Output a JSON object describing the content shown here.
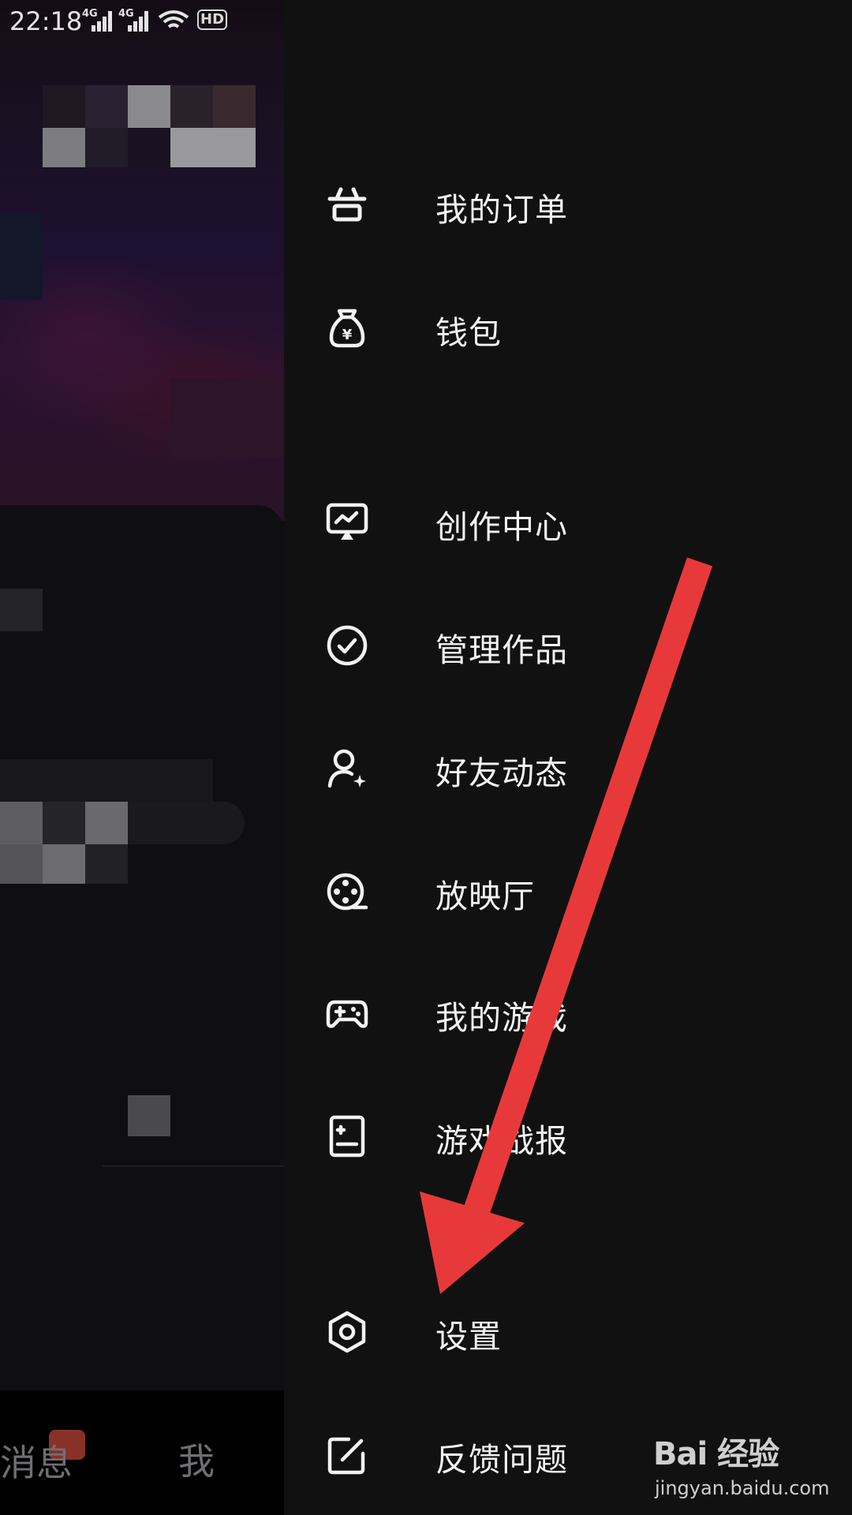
{
  "status_bar": {
    "time": "22:18",
    "network_1": "4G",
    "network_2": "4G",
    "hd_badge": "HD",
    "icons": [
      "signal-icon",
      "wifi-icon",
      "mute-bell-icon",
      "rotation-lock-icon",
      "battery-icon"
    ]
  },
  "background": {
    "tabs": {
      "messages": "消息",
      "me": "我"
    }
  },
  "drawer": {
    "items": [
      {
        "label": "我的订单",
        "icon": "order-store-icon"
      },
      {
        "label": "钱包",
        "icon": "wallet-bag-icon"
      },
      {
        "label": "创作中心",
        "icon": "creator-center-icon"
      },
      {
        "label": "管理作品",
        "icon": "check-circle-icon"
      },
      {
        "label": "好友动态",
        "icon": "friend-activity-icon"
      },
      {
        "label": "放映厅",
        "icon": "film-reel-icon"
      },
      {
        "label": "我的游戏",
        "icon": "gamepad-icon"
      },
      {
        "label": "游戏战报",
        "icon": "report-icon"
      },
      {
        "label": "设置",
        "icon": "settings-hexagon-icon"
      },
      {
        "label": "反馈问题",
        "icon": "feedback-edit-icon"
      }
    ]
  },
  "annotation": {
    "color": "#e8393a"
  },
  "watermark": {
    "logo": "Bai 经验",
    "url": "jingyan.baidu.com"
  }
}
